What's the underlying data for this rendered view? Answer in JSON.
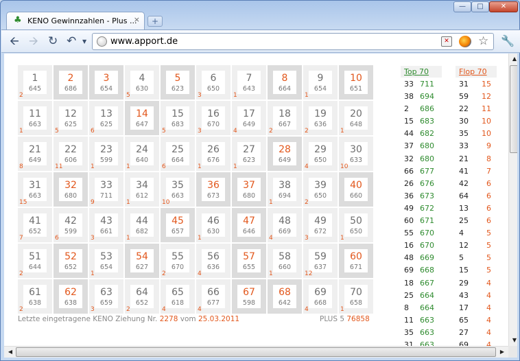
{
  "browser": {
    "tab_title": "KENO Gewinnzahlen - Plus ...",
    "url": "www.apport.de",
    "newtab_label": "+",
    "close_label": "×"
  },
  "colors": {
    "accent": "#e2571c",
    "green": "#2e8b2e",
    "hot_cell": "#dcdcdc",
    "cell": "#efefef"
  },
  "keno": {
    "cells": [
      {
        "n": "1",
        "f": "645",
        "r": "2",
        "hot": false
      },
      {
        "n": "2",
        "f": "686",
        "r": "",
        "hot": true
      },
      {
        "n": "3",
        "f": "654",
        "r": "",
        "hot": true
      },
      {
        "n": "4",
        "f": "630",
        "r": "5",
        "hot": false
      },
      {
        "n": "5",
        "f": "623",
        "r": "",
        "hot": true
      },
      {
        "n": "6",
        "f": "650",
        "r": "3",
        "hot": false
      },
      {
        "n": "7",
        "f": "643",
        "r": "1",
        "hot": false
      },
      {
        "n": "8",
        "f": "664",
        "r": "",
        "hot": true
      },
      {
        "n": "9",
        "f": "654",
        "r": "1",
        "hot": false
      },
      {
        "n": "10",
        "f": "651",
        "r": "",
        "hot": true
      },
      {
        "n": "11",
        "f": "663",
        "r": "1",
        "hot": false
      },
      {
        "n": "12",
        "f": "625",
        "r": "5",
        "hot": false
      },
      {
        "n": "13",
        "f": "625",
        "r": "6",
        "hot": false
      },
      {
        "n": "14",
        "f": "647",
        "r": "",
        "hot": true
      },
      {
        "n": "15",
        "f": "683",
        "r": "5",
        "hot": false
      },
      {
        "n": "16",
        "f": "670",
        "r": "3",
        "hot": false
      },
      {
        "n": "17",
        "f": "649",
        "r": "4",
        "hot": false
      },
      {
        "n": "18",
        "f": "667",
        "r": "2",
        "hot": false
      },
      {
        "n": "19",
        "f": "636",
        "r": "2",
        "hot": false
      },
      {
        "n": "20",
        "f": "648",
        "r": "1",
        "hot": false
      },
      {
        "n": "21",
        "f": "649",
        "r": "8",
        "hot": false
      },
      {
        "n": "22",
        "f": "606",
        "r": "11",
        "hot": false
      },
      {
        "n": "23",
        "f": "599",
        "r": "1",
        "hot": false
      },
      {
        "n": "24",
        "f": "640",
        "r": "1",
        "hot": false
      },
      {
        "n": "25",
        "f": "664",
        "r": "6",
        "hot": false
      },
      {
        "n": "26",
        "f": "676",
        "r": "1",
        "hot": false
      },
      {
        "n": "27",
        "f": "623",
        "r": "1",
        "hot": false
      },
      {
        "n": "28",
        "f": "649",
        "r": "",
        "hot": true
      },
      {
        "n": "29",
        "f": "650",
        "r": "4",
        "hot": false
      },
      {
        "n": "30",
        "f": "633",
        "r": "10",
        "hot": false
      },
      {
        "n": "31",
        "f": "663",
        "r": "15",
        "hot": false
      },
      {
        "n": "32",
        "f": "680",
        "r": "",
        "hot": true
      },
      {
        "n": "33",
        "f": "711",
        "r": "9",
        "hot": false
      },
      {
        "n": "34",
        "f": "612",
        "r": "1",
        "hot": false
      },
      {
        "n": "35",
        "f": "663",
        "r": "10",
        "hot": false
      },
      {
        "n": "36",
        "f": "673",
        "r": "",
        "hot": true
      },
      {
        "n": "37",
        "f": "680",
        "r": "",
        "hot": true
      },
      {
        "n": "38",
        "f": "694",
        "r": "1",
        "hot": false
      },
      {
        "n": "39",
        "f": "650",
        "r": "2",
        "hot": false
      },
      {
        "n": "40",
        "f": "660",
        "r": "",
        "hot": true
      },
      {
        "n": "41",
        "f": "652",
        "r": "7",
        "hot": false
      },
      {
        "n": "42",
        "f": "599",
        "r": "6",
        "hot": false
      },
      {
        "n": "43",
        "f": "661",
        "r": "3",
        "hot": false
      },
      {
        "n": "44",
        "f": "682",
        "r": "1",
        "hot": false
      },
      {
        "n": "45",
        "f": "657",
        "r": "",
        "hot": true
      },
      {
        "n": "46",
        "f": "630",
        "r": "1",
        "hot": false
      },
      {
        "n": "47",
        "f": "646",
        "r": "",
        "hot": true
      },
      {
        "n": "48",
        "f": "669",
        "r": "4",
        "hot": false
      },
      {
        "n": "49",
        "f": "672",
        "r": "3",
        "hot": false
      },
      {
        "n": "50",
        "f": "650",
        "r": "1",
        "hot": false
      },
      {
        "n": "51",
        "f": "644",
        "r": "2",
        "hot": false
      },
      {
        "n": "52",
        "f": "652",
        "r": "",
        "hot": true
      },
      {
        "n": "53",
        "f": "654",
        "r": "1",
        "hot": false
      },
      {
        "n": "54",
        "f": "627",
        "r": "",
        "hot": true
      },
      {
        "n": "55",
        "f": "670",
        "r": "2",
        "hot": false
      },
      {
        "n": "56",
        "f": "636",
        "r": "4",
        "hot": false
      },
      {
        "n": "57",
        "f": "655",
        "r": "",
        "hot": true
      },
      {
        "n": "58",
        "f": "660",
        "r": "1",
        "hot": false
      },
      {
        "n": "59",
        "f": "637",
        "r": "12",
        "hot": false
      },
      {
        "n": "60",
        "f": "671",
        "r": "",
        "hot": true
      },
      {
        "n": "61",
        "f": "638",
        "r": "2",
        "hot": false
      },
      {
        "n": "62",
        "f": "638",
        "r": "",
        "hot": true
      },
      {
        "n": "63",
        "f": "659",
        "r": "3",
        "hot": false
      },
      {
        "n": "64",
        "f": "652",
        "r": "2",
        "hot": false
      },
      {
        "n": "65",
        "f": "618",
        "r": "4",
        "hot": false
      },
      {
        "n": "66",
        "f": "677",
        "r": "4",
        "hot": false
      },
      {
        "n": "67",
        "f": "598",
        "r": "",
        "hot": true
      },
      {
        "n": "68",
        "f": "642",
        "r": "",
        "hot": true
      },
      {
        "n": "69",
        "f": "668",
        "r": "4",
        "hot": false
      },
      {
        "n": "70",
        "f": "658",
        "r": "1",
        "hot": false
      }
    ],
    "footer": {
      "prefix": "Letzte eingetragene KENO Ziehung Nr.",
      "draw_no": "2278",
      "vom": "vom",
      "date": "25.03.2011",
      "plus_label": "PLUS 5",
      "plus_value": "76858"
    }
  },
  "top": {
    "title": "Top 70",
    "rows": [
      [
        "33",
        "711"
      ],
      [
        "38",
        "694"
      ],
      [
        "2",
        "686"
      ],
      [
        "15",
        "683"
      ],
      [
        "44",
        "682"
      ],
      [
        "37",
        "680"
      ],
      [
        "32",
        "680"
      ],
      [
        "66",
        "677"
      ],
      [
        "26",
        "676"
      ],
      [
        "36",
        "673"
      ],
      [
        "49",
        "672"
      ],
      [
        "60",
        "671"
      ],
      [
        "55",
        "670"
      ],
      [
        "16",
        "670"
      ],
      [
        "48",
        "669"
      ],
      [
        "69",
        "668"
      ],
      [
        "18",
        "667"
      ],
      [
        "25",
        "664"
      ],
      [
        "8",
        "664"
      ],
      [
        "11",
        "663"
      ],
      [
        "35",
        "663"
      ],
      [
        "31",
        "663"
      ]
    ]
  },
  "flop": {
    "title": "Flop 70",
    "rows": [
      [
        "31",
        "15"
      ],
      [
        "59",
        "12"
      ],
      [
        "22",
        "11"
      ],
      [
        "30",
        "10"
      ],
      [
        "35",
        "10"
      ],
      [
        "33",
        "9"
      ],
      [
        "21",
        "8"
      ],
      [
        "41",
        "7"
      ],
      [
        "42",
        "6"
      ],
      [
        "64",
        "6"
      ],
      [
        "13",
        "6"
      ],
      [
        "25",
        "6"
      ],
      [
        "4",
        "5"
      ],
      [
        "12",
        "5"
      ],
      [
        "5",
        "5"
      ],
      [
        "15",
        "5"
      ],
      [
        "29",
        "4"
      ],
      [
        "43",
        "4"
      ],
      [
        "17",
        "4"
      ],
      [
        "65",
        "4"
      ],
      [
        "27",
        "4"
      ],
      [
        "69",
        "4"
      ]
    ]
  }
}
